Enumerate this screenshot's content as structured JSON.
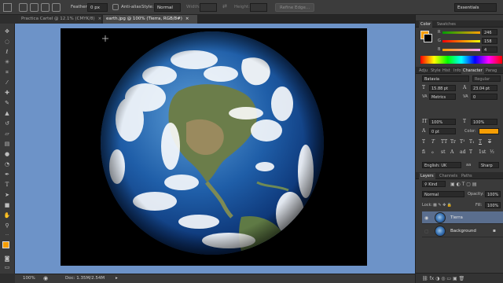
{
  "options_bar": {
    "feather_label": "Feather:",
    "feather_value": "0 px",
    "anti_alias_label": "Anti-alias",
    "style_label": "Style:",
    "style_value": "Normal",
    "width_label": "Width:",
    "height_label": "Height:",
    "refine_edge_label": "Refine Edge...",
    "workspace_value": "Essentials"
  },
  "tabs": [
    {
      "label": "Practica Cartel @ 12.1% (CMYK/8)",
      "close": "×",
      "active": false
    },
    {
      "label": "earth.jpg @ 100% (Tierra, RGB/8#)",
      "close": "×",
      "active": true
    }
  ],
  "status_bar": {
    "zoom": "100%",
    "doc_info": "Doc: 1.35M/2.54M"
  },
  "color_panel": {
    "tabs": [
      "Color",
      "Swatches"
    ],
    "channels": [
      {
        "label": "R",
        "value": "246"
      },
      {
        "label": "G",
        "value": "158"
      },
      {
        "label": "B",
        "value": "4"
      }
    ],
    "foreground_color": "#f69e04",
    "background_color": "#000000"
  },
  "character_panel": {
    "tabs": [
      "Adju",
      "Style",
      "Hist",
      "Info",
      "Character",
      "Parag"
    ],
    "active_tab": "Character",
    "font_family": "Batavia",
    "font_style": "Regular",
    "font_size": "15.88 pt",
    "leading": "23.04 pt",
    "kerning": "Metrics",
    "tracking": "0",
    "vertical_scale": "100%",
    "horizontal_scale": "100%",
    "baseline_shift": "0 pt",
    "color_label": "Color:",
    "text_color": "#f69e04",
    "style_buttons": [
      "T",
      "T",
      "TT",
      "Tr",
      "T¹",
      "T₁",
      "T",
      "T"
    ],
    "opentype_buttons": [
      "fi",
      "ℴ",
      "st",
      "A",
      "ad",
      "T",
      "1st",
      "½"
    ],
    "language": "English: UK",
    "antialias": "Sharp",
    "aa_icon": "aa"
  },
  "layers_panel": {
    "tabs": [
      "Layers",
      "Channels",
      "Paths"
    ],
    "filter_kind": "Kind",
    "blend_mode": "Normal",
    "opacity_label": "Opacity:",
    "opacity_value": "100%",
    "lock_label": "Lock:",
    "fill_label": "Fill:",
    "fill_value": "100%",
    "layers": [
      {
        "name": "Tierra",
        "visible": true,
        "selected": true
      },
      {
        "name": "Background",
        "visible": false,
        "selected": false,
        "locked": true
      }
    ]
  },
  "colors": {
    "canvas_bg": "#6d93c8",
    "ui_dark": "#2e2e2e",
    "accent_orange": "#f69e04"
  }
}
